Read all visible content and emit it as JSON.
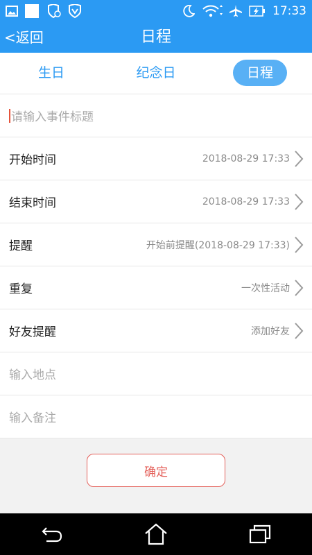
{
  "status_bar": {
    "time": "17:33",
    "left_icons": [
      "image-icon",
      "white-square-icon",
      "shield-refresh-icon",
      "v-shield-icon"
    ],
    "right_icons": [
      "moon-icon",
      "wifi-icon",
      "airplane-icon",
      "battery-charging-icon"
    ]
  },
  "header": {
    "back_label": "<返回",
    "title": "日程"
  },
  "tabs": [
    {
      "label": "生日",
      "selected": false
    },
    {
      "label": "纪念日",
      "selected": false
    },
    {
      "label": "日程",
      "selected": true
    }
  ],
  "form": {
    "title_input": {
      "placeholder": "请输入事件标题",
      "value": ""
    },
    "rows": [
      {
        "label": "开始时间",
        "value": "2018-08-29 17:33"
      },
      {
        "label": "结束时间",
        "value": "2018-08-29 17:33"
      },
      {
        "label": "提醒",
        "value": "开始前提醒(2018-08-29 17:33)"
      },
      {
        "label": "重复",
        "value": "一次性活动"
      },
      {
        "label": "好友提醒",
        "value": "添加好友"
      }
    ],
    "location_input": {
      "placeholder": "输入地点"
    },
    "note_input": {
      "placeholder": "输入备注"
    }
  },
  "confirm_label": "确定",
  "colors": {
    "primary": "#2b9af3",
    "tab_selected_bg": "#58b0f5",
    "confirm": "#e4605a"
  }
}
